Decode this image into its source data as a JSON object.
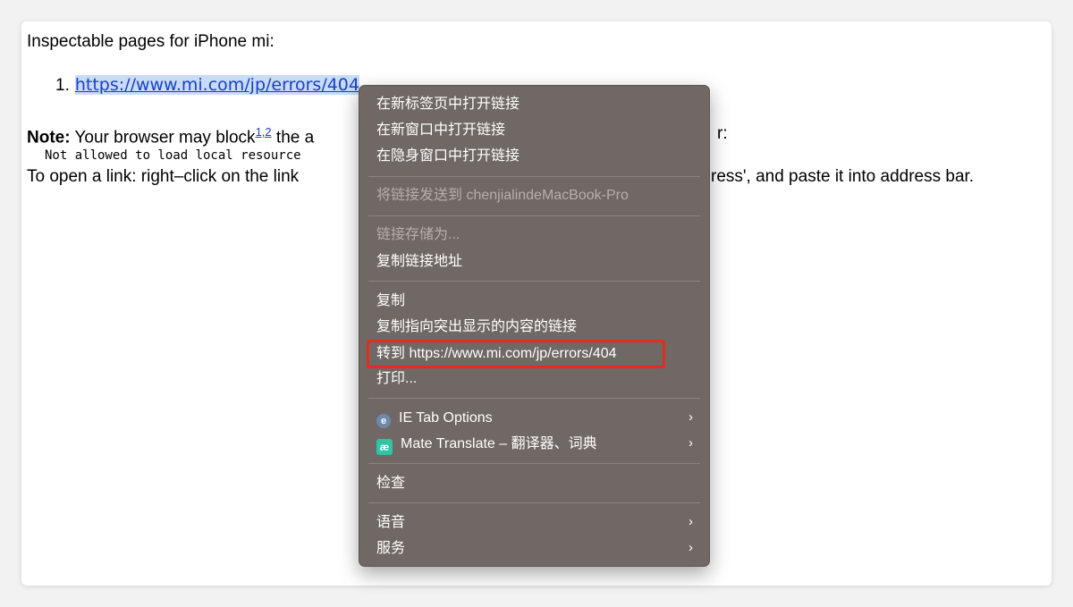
{
  "page": {
    "heading": "Inspectable pages for iPhone mi:",
    "list": [
      {
        "number": "1.",
        "link": "https://www.mi.com/jp/errors/404"
      }
    ],
    "note": {
      "label": "Note:",
      "text": " Your browser may block",
      "sup": "1,2",
      "after": " the a",
      "tail": "r:"
    },
    "mono_text": "Not allowed to load local resource",
    "open_text": "To open a link: right–click on the link",
    "open_tail": "ress', and paste it into address bar."
  },
  "context_menu": {
    "items": {
      "open_new_tab": "在新标签页中打开链接",
      "open_new_window": "在新窗口中打开链接",
      "open_private": "在隐身窗口中打开链接",
      "send_to_device": "将链接发送到 chenjialindeMacBook-Pro",
      "save_link_as": "链接存储为...",
      "copy_link": "复制链接地址",
      "copy": "复制",
      "copy_highlight_link": "复制指向突出显示的内容的链接",
      "goto_link": "转到 https://www.mi.com/jp/errors/404",
      "print": "打印...",
      "ie_tab": "IE Tab Options",
      "mate_translate": "Mate Translate – 翻译器、词典",
      "inspect": "检查",
      "speech": "语音",
      "services": "服务"
    },
    "icons": {
      "ie_tab": "ie-tab-icon",
      "mate": "mate-translate-icon"
    },
    "highlight_color": "#e22d20"
  }
}
